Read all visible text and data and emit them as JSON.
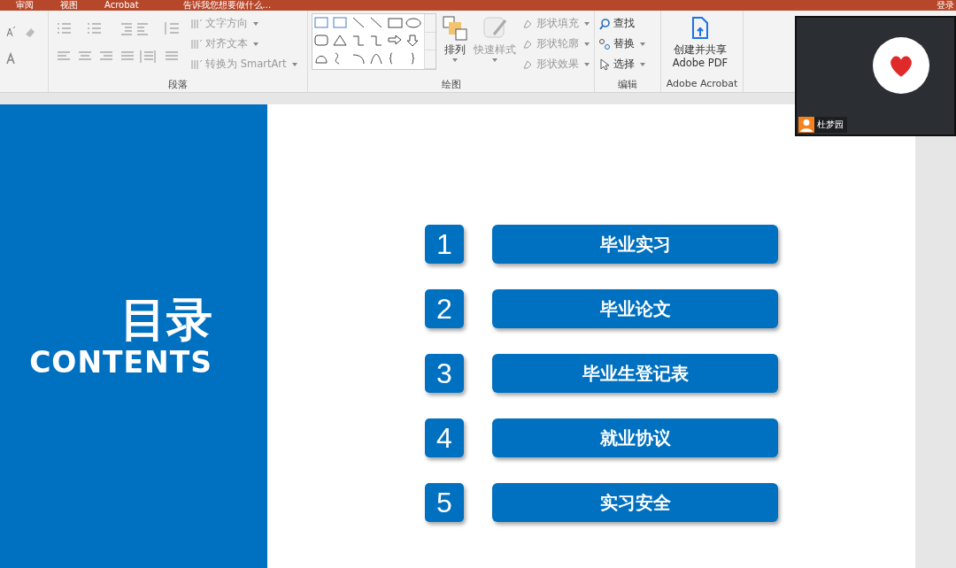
{
  "title_bar": {
    "tabs": [
      {
        "label": "审阅"
      },
      {
        "label": "视图"
      },
      {
        "label": "Acrobat"
      }
    ],
    "tell_me": "告诉我您想要做什么...",
    "account": "登录"
  },
  "ribbon": {
    "groups": [
      {
        "kind": "paragraph",
        "label": "段落",
        "commands": [
          {
            "label": "文字方向",
            "disabled": true
          },
          {
            "label": "对齐文本",
            "disabled": true
          },
          {
            "label": "转换为 SmartArt",
            "disabled": true
          }
        ]
      },
      {
        "kind": "drawing",
        "label": "绘图",
        "commands": [
          {
            "label": "排列",
            "disabled": false
          },
          {
            "label": "快速样式",
            "disabled": true
          },
          {
            "label": "形状填充",
            "disabled": true
          },
          {
            "label": "形状轮廓",
            "disabled": true
          },
          {
            "label": "形状效果",
            "disabled": true
          }
        ]
      },
      {
        "kind": "editing",
        "label": "编辑",
        "commands": [
          {
            "label": "查找",
            "disabled": false
          },
          {
            "label": "替换",
            "disabled": false
          },
          {
            "label": "选择",
            "disabled": false
          }
        ]
      },
      {
        "kind": "acrobat",
        "label": "Adobe Acrobat",
        "commands": [
          {
            "label": "创建并共享 Adobe PDF",
            "disabled": false
          }
        ]
      }
    ]
  },
  "slide": {
    "title": "目录",
    "subtitle": "CONTENTS",
    "items": [
      {
        "number": "1",
        "label": "毕业实习"
      },
      {
        "number": "2",
        "label": "毕业论文"
      },
      {
        "number": "3",
        "label": "毕业生登记表"
      },
      {
        "number": "4",
        "label": "就业协议"
      },
      {
        "number": "5",
        "label": "实习安全"
      }
    ]
  },
  "video": {
    "name": "杜梦园"
  }
}
